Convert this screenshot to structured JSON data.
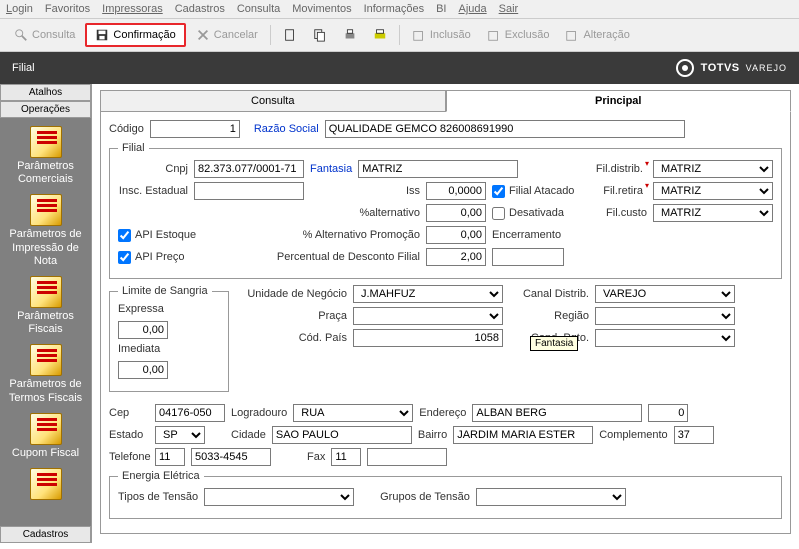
{
  "menu": {
    "login": "Login",
    "favoritos": "Favoritos",
    "impressoras": "Impressoras",
    "cadastros": "Cadastros",
    "consulta": "Consulta",
    "movimentos": "Movimentos",
    "informacoes": "Informações",
    "bi": "BI",
    "ajuda": "Ajuda",
    "sair": "Sair"
  },
  "toolbar": {
    "consulta": "Consulta",
    "confirmacao": "Confirmação",
    "cancelar": "Cancelar",
    "inclusao": "Inclusão",
    "exclusao": "Exclusão",
    "alteracao": "Alteração"
  },
  "title": "Filial",
  "brand": {
    "name": "TOTVS",
    "sub": "VAREJO"
  },
  "sidebar": {
    "tabs": {
      "atalhos": "Atalhos",
      "operacoes": "Operações",
      "cadastros": "Cadastros"
    },
    "items": [
      {
        "label": "Parâmetros Comerciais"
      },
      {
        "label": "Parâmetros de Impressão de Nota"
      },
      {
        "label": "Parâmetros Fiscais"
      },
      {
        "label": "Parâmetros de Termos Fiscais"
      },
      {
        "label": "Cupom Fiscal"
      }
    ]
  },
  "tabs": {
    "consulta": "Consulta",
    "principal": "Principal"
  },
  "form": {
    "codigo_label": "Código",
    "codigo": "1",
    "razao_label": "Razão Social",
    "razao": "QUALIDADE GEMCO 826008691990",
    "filial_legend": "Filial",
    "cnpj_label": "Cnpj",
    "cnpj": "82.373.077/0001-71",
    "fantasia_label": "Fantasia",
    "fantasia": "MATRIZ",
    "tooltip_fantasia": "Fantasia",
    "insc_label": "Insc. Estadual",
    "insc": "",
    "iss_label": "Iss",
    "iss": "0,0000",
    "filial_atacado": "Filial Atacado",
    "pct_alt_label": "%alternativo",
    "pct_alt": "0,00",
    "desativada": "Desativada",
    "api_estoque": "API Estoque",
    "pct_alt_promo_label": "% Alternativo Promoção",
    "pct_alt_promo": "0,00",
    "encerramento_label": "Encerramento",
    "encerramento": "",
    "api_preco": "API Preço",
    "pct_desc_label": "Percentual de Desconto Filial",
    "pct_desc": "2,00",
    "fil_distrib_label": "Fil.distrib.",
    "fil_distrib": "MATRIZ",
    "fil_retira_label": "Fil.retira",
    "fil_retira": "MATRIZ",
    "fil_custo_label": "Fil.custo",
    "fil_custo": "MATRIZ",
    "sangria_legend": "Limite de Sangria",
    "expressa_label": "Expressa",
    "expressa": "0,00",
    "imediata_label": "Imediata",
    "imediata": "0,00",
    "unidade_label": "Unidade de Negócio",
    "unidade": "J.MAHFUZ",
    "canal_label": "Canal Distrib.",
    "canal": "VAREJO",
    "praca_label": "Praça",
    "praca": "",
    "regiao_label": "Região",
    "regiao": "",
    "codpais_label": "Cód. País",
    "codpais": "1058",
    "condpgto_label": "Cond. Pgto.",
    "condpgto": "",
    "cep_label": "Cep",
    "cep": "04176-050",
    "logradouro_label": "Logradouro",
    "logradouro": "RUA",
    "endereco_label": "Endereço",
    "endereco": "ALBAN BERG",
    "endereco_num": "0",
    "estado_label": "Estado",
    "estado": "SP",
    "cidade_label": "Cidade",
    "cidade": "SAO PAULO",
    "bairro_label": "Bairro",
    "bairro": "JARDIM MARIA ESTER",
    "complemento_label": "Complemento",
    "complemento": "37",
    "telefone_label": "Telefone",
    "telefone_ddd": "11",
    "telefone": "5033-4545",
    "fax_label": "Fax",
    "fax_ddd": "11",
    "fax": "",
    "energia_legend": "Energia Elétrica",
    "tipos_tensao_label": "Tipos de Tensão",
    "grupos_tensao_label": "Grupos de Tensão"
  }
}
